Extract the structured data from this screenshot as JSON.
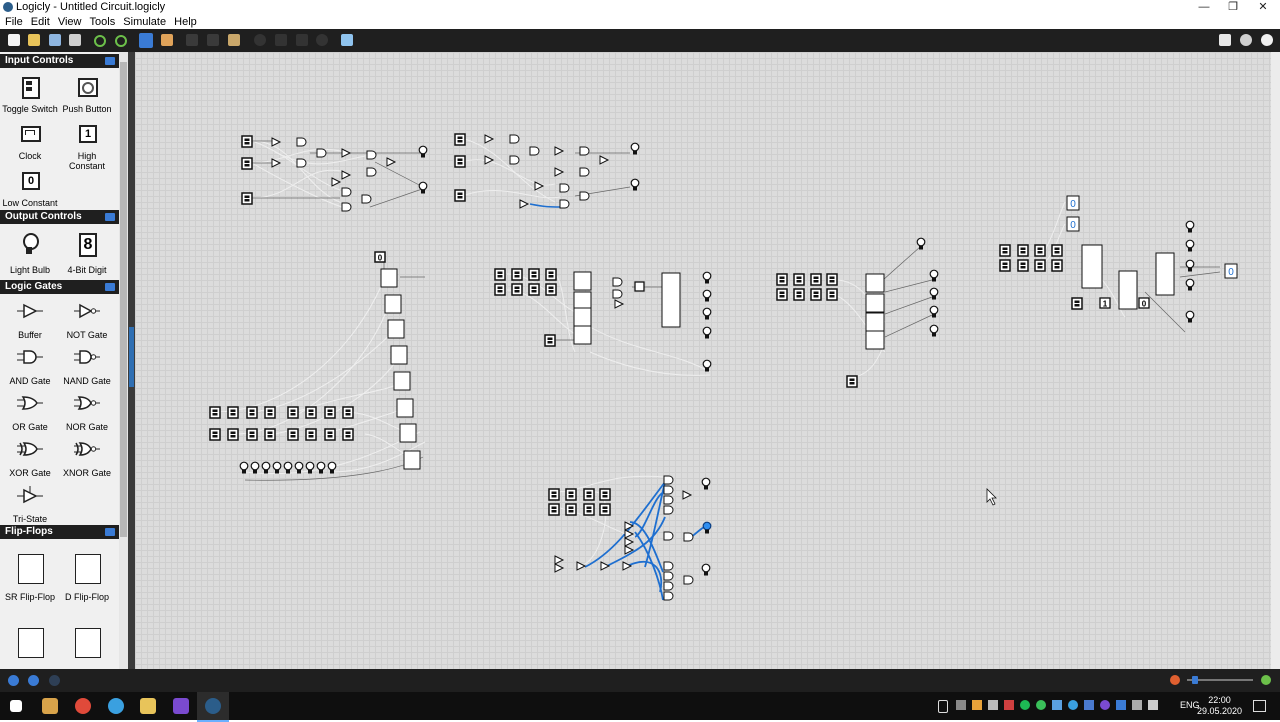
{
  "window": {
    "title": "Logicly - Untitled Circuit.logicly",
    "controls": [
      "—",
      "❐",
      "✕"
    ]
  },
  "menu": [
    "File",
    "Edit",
    "View",
    "Tools",
    "Simulate",
    "Help"
  ],
  "palette": {
    "sections": [
      {
        "title": "Input Controls",
        "items": [
          "Toggle Switch",
          "Push Button",
          "Clock",
          "High Constant",
          "Low Constant"
        ]
      },
      {
        "title": "Output Controls",
        "items": [
          "Light Bulb",
          "4-Bit Digit"
        ]
      },
      {
        "title": "Logic Gates",
        "items": [
          "Buffer",
          "NOT Gate",
          "AND Gate",
          "NAND Gate",
          "OR Gate",
          "NOR Gate",
          "XOR Gate",
          "XNOR Gate",
          "Tri-State"
        ]
      },
      {
        "title": "Flip-Flops",
        "items": [
          "SR Flip-Flop",
          "D Flip-Flop"
        ]
      }
    ]
  },
  "icons": {
    "high_constant": "1",
    "low_constant": "0",
    "digit": "8",
    "circuit_digit": "0"
  },
  "taskbar": {
    "language": "ENG",
    "time": "22:00",
    "date": "29.05.2020"
  },
  "colors": {
    "canvas": "#dcdcdc",
    "accent": "#2f6fb3",
    "wire_active": "#1e6fd0"
  }
}
